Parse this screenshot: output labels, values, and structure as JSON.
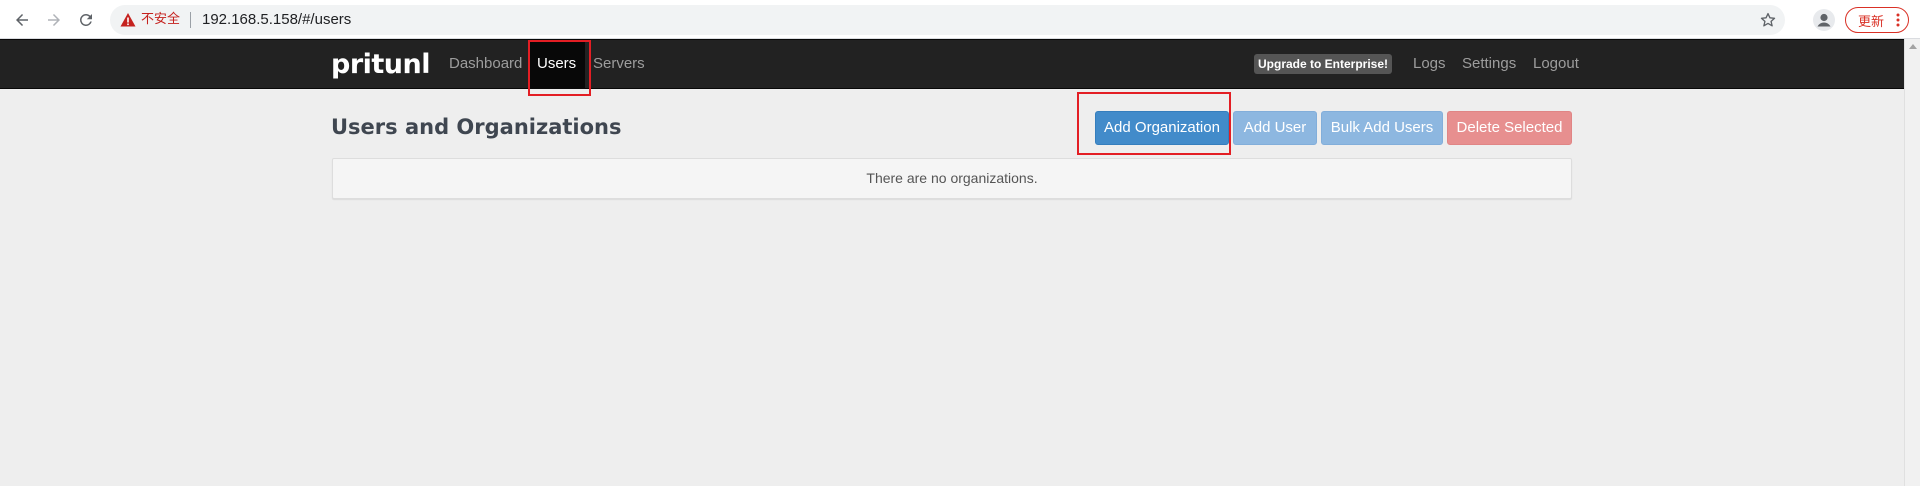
{
  "browser": {
    "insecure_label": "不安全",
    "url": "192.168.5.158/#/users",
    "update_label": "更新"
  },
  "app": {
    "brand": "pritunl",
    "nav": {
      "dashboard": "Dashboard",
      "users": "Users",
      "servers": "Servers",
      "upgrade": "Upgrade to Enterprise!",
      "logs": "Logs",
      "settings": "Settings",
      "logout": "Logout"
    },
    "active_tab": "Users"
  },
  "page": {
    "title": "Users and Organizations",
    "buttons": {
      "add_organization": "Add Organization",
      "add_user": "Add User",
      "bulk_add_users": "Bulk Add Users",
      "delete_selected": "Delete Selected"
    },
    "empty_message": "There are no organizations."
  },
  "colors": {
    "navbar": "#222222",
    "primary": "#428bca",
    "info": "#8db7e0",
    "danger": "#e78f8f",
    "annotation": "#e31e24"
  }
}
